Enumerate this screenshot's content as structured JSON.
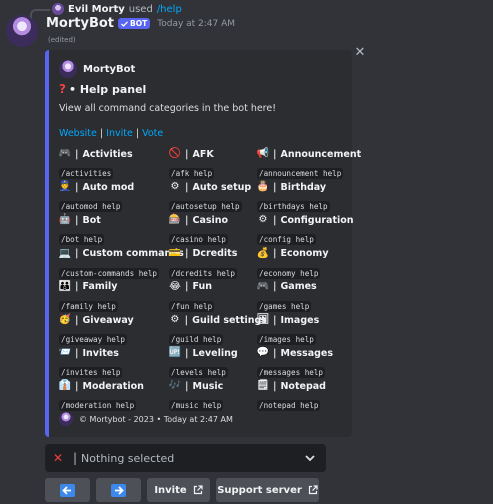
{
  "reply": {
    "user": "Evil Morty",
    "verb": "used",
    "command": "/help"
  },
  "message": {
    "author": "MortyBot",
    "badge": "BOT",
    "timestamp": "Today at 2:47 AM",
    "edited": "(edited)"
  },
  "embed": {
    "accent_color": "#5865f2",
    "author": "MortyBot",
    "title_icon": "?",
    "title": "• Help panel",
    "description": "View all command categories in the bot here!",
    "links": [
      {
        "label": "Website"
      },
      {
        "label": "Invite"
      },
      {
        "label": "Vote"
      }
    ],
    "link_separator": "|",
    "fields": [
      {
        "icon": "activities-icon",
        "glyph": "🎮",
        "name": "Activities",
        "value": "/activities"
      },
      {
        "icon": "afk-icon",
        "glyph": "🚫",
        "name": "AFK",
        "value": "/afk help"
      },
      {
        "icon": "announcement-icon",
        "glyph": "📢",
        "name": "Announcement",
        "value": "/announcement help"
      },
      {
        "icon": "automod-icon",
        "glyph": "👮",
        "name": "Auto mod",
        "value": "/automod help"
      },
      {
        "icon": "autosetup-icon",
        "glyph": "⚙",
        "name": "Auto setup",
        "value": "/autosetup help"
      },
      {
        "icon": "birthday-icon",
        "glyph": "🎂",
        "name": "Birthday",
        "value": "/birthdays help"
      },
      {
        "icon": "bot-icon",
        "glyph": "🤖",
        "name": "Bot",
        "value": "/bot help"
      },
      {
        "icon": "casino-icon",
        "glyph": "🎰",
        "name": "Casino",
        "value": "/casino help"
      },
      {
        "icon": "configuration-icon",
        "glyph": "⚙",
        "name": "Configuration",
        "value": "/config help"
      },
      {
        "icon": "custom-commands-icon",
        "glyph": "💻",
        "name": "Custom commands",
        "value": "/custom-commands help"
      },
      {
        "icon": "dcredits-icon",
        "glyph": "💳",
        "name": "Dcredits",
        "value": "/dcredits help"
      },
      {
        "icon": "economy-icon",
        "glyph": "💰",
        "name": "Economy",
        "value": "/economy help"
      },
      {
        "icon": "family-icon",
        "glyph": "👪",
        "name": "Family",
        "value": "/family help"
      },
      {
        "icon": "fun-icon",
        "glyph": "😂",
        "name": "Fun",
        "value": "/fun help"
      },
      {
        "icon": "games-icon",
        "glyph": "🎮",
        "name": "Games",
        "value": "/games help"
      },
      {
        "icon": "giveaway-icon",
        "glyph": "🥳",
        "name": "Giveaway",
        "value": "/giveaway help"
      },
      {
        "icon": "guild-settings-icon",
        "glyph": "⚙",
        "name": "Guild settings",
        "value": "/guild help"
      },
      {
        "icon": "images-icon",
        "glyph": "🖼",
        "name": "Images",
        "value": "/images help"
      },
      {
        "icon": "invites-icon",
        "glyph": "📨",
        "name": "Invites",
        "value": "/invites help"
      },
      {
        "icon": "leveling-icon",
        "glyph": "🆙",
        "name": "Leveling",
        "value": "/levels help"
      },
      {
        "icon": "messages-icon",
        "glyph": "💬",
        "name": "Messages",
        "value": "/messages help"
      },
      {
        "icon": "moderation-icon",
        "glyph": "👔",
        "name": "Moderation",
        "value": "/moderation help"
      },
      {
        "icon": "music-icon",
        "glyph": "🎶",
        "name": "Music",
        "value": "/music help"
      },
      {
        "icon": "notepad-icon",
        "glyph": "🗒",
        "name": "Notepad",
        "value": "/notepad help"
      }
    ],
    "footer": "© Mortybot - 2023 • Today at 2:47 AM"
  },
  "select_menu": {
    "placeholder": "Nothing selected",
    "icon": "x-icon"
  },
  "buttons": {
    "prev_icon": "arrow-left-icon",
    "next_icon": "arrow-right-icon",
    "invite": "Invite",
    "support": "Support server"
  }
}
